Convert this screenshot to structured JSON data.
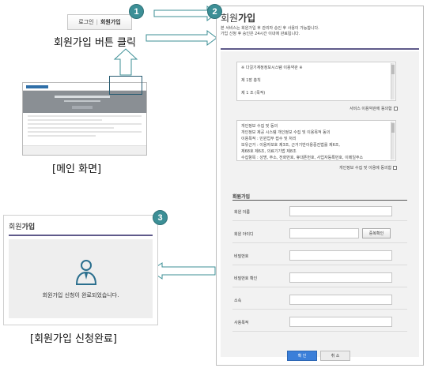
{
  "steps": [
    "1",
    "2",
    "3"
  ],
  "login_box": {
    "login": "로그인",
    "separator": "|",
    "signup": "회원가입"
  },
  "captions": {
    "step1": "회원가입 버튼 클릭",
    "main": "[메인 화면]",
    "complete": "[회원가입 신청완료]"
  },
  "result_panel": {
    "title_prefix": "회원",
    "title_bold": "가입",
    "message": "회원가입 신청이 완료되었습니다."
  },
  "signup_page": {
    "title_prefix": "회원",
    "title_bold": "가입",
    "desc_line1": "본 서비스는 회원가입 후 관리자 승인 후 사용이 가능합니다.",
    "desc_line2": "가입 신청 후 승인은 24시간 이내에 완료됩니다.",
    "terms1_lines": [
      "※ 다걸기계정정보시스템 이용약관 ※",
      "",
      "제 1장 총칙",
      "",
      "제 1 조 (목적)"
    ],
    "terms1_agree": "서비스 이용약관에 동의함",
    "terms2_lines": [
      "개인정보 수집 및 동의",
      "개인정보 제공 시스템 개인정보 수집 및 이용목적 동의",
      "이용목적 : 민원업무 접수 및 처리",
      "보유근거 : 이용자보호 제3조, 근거기반이용증진법률 제6조,",
      "제68호 제6조, 의료기기법 제8조",
      "수집항목 : 성명, 주소, 전화번호, 휴대폰번호, 사업자등록번호, 이메일주소"
    ],
    "terms2_agree": "개인정보 수집 및 이용에 동의함",
    "section_title": "회원가입",
    "fields": [
      {
        "label": "회원 이름"
      },
      {
        "label": "회원 아이디",
        "button": "중복확인"
      },
      {
        "label": "비밀번호"
      },
      {
        "label": "비밀번호 확인"
      },
      {
        "label": "소속"
      },
      {
        "label": "사용목적"
      }
    ],
    "ok_label": "확 인",
    "cancel_label": "취 소"
  },
  "colors": {
    "accent_badge": "#3c8f96",
    "title_rule": "#5f5a8a",
    "confirm_button": "#3b7fd9",
    "arrow": "#3c8f96"
  }
}
